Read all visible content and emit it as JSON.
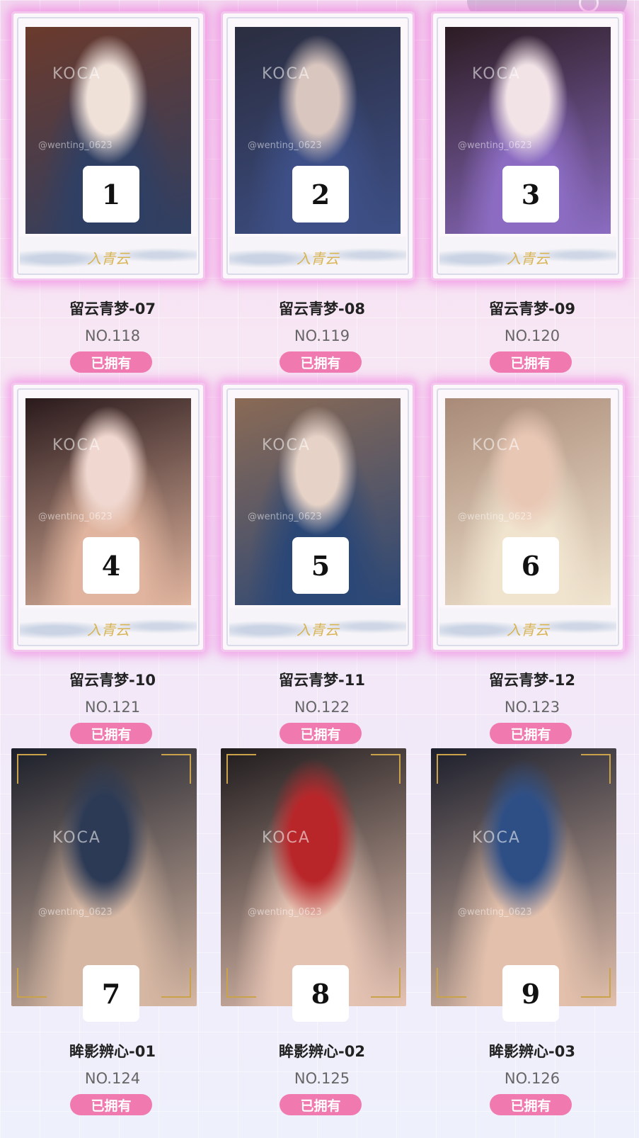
{
  "watermark": {
    "brand": "KOCA",
    "handle": "@wenting_0623"
  },
  "frame_logo": "入青云",
  "cards": [
    {
      "number": "1",
      "title": "留云青梦-07",
      "no": "NO.118",
      "status": "已拥有",
      "palette": [
        "#6b3a2c",
        "#2f3f63",
        "#efe0d8"
      ]
    },
    {
      "number": "2",
      "title": "留云青梦-08",
      "no": "NO.119",
      "status": "已拥有",
      "palette": [
        "#2b2d3f",
        "#3d4f86",
        "#d9c6bf"
      ]
    },
    {
      "number": "3",
      "title": "留云青梦-09",
      "no": "NO.120",
      "status": "已拥有",
      "palette": [
        "#2c1b22",
        "#8b6cc2",
        "#f2e3e7"
      ]
    },
    {
      "number": "4",
      "title": "留云青梦-10",
      "no": "NO.121",
      "status": "已拥有",
      "palette": [
        "#2a1a1c",
        "#e0b49e",
        "#f0d8d0"
      ]
    },
    {
      "number": "5",
      "title": "留云青梦-11",
      "no": "NO.122",
      "status": "已拥有",
      "palette": [
        "#8a6a55",
        "#2b4776",
        "#e6d2c6"
      ]
    },
    {
      "number": "6",
      "title": "留云青梦-12",
      "no": "NO.123",
      "status": "已拥有",
      "palette": [
        "#a98a78",
        "#f0e4cf",
        "#e9c7b5"
      ]
    },
    {
      "number": "7",
      "title": "眸影辨心-01",
      "no": "NO.124",
      "status": "已拥有",
      "palette": [
        "#1b1f2a",
        "#d6b7a3",
        "#2c3a55"
      ]
    },
    {
      "number": "8",
      "title": "眸影辨心-02",
      "no": "NO.125",
      "status": "已拥有",
      "palette": [
        "#1f1b1d",
        "#e5c3b3",
        "#b8262a"
      ]
    },
    {
      "number": "9",
      "title": "眸影辨心-03",
      "no": "NO.126",
      "status": "已拥有",
      "palette": [
        "#1c1f2c",
        "#e2c0ac",
        "#2e4f86"
      ]
    }
  ]
}
